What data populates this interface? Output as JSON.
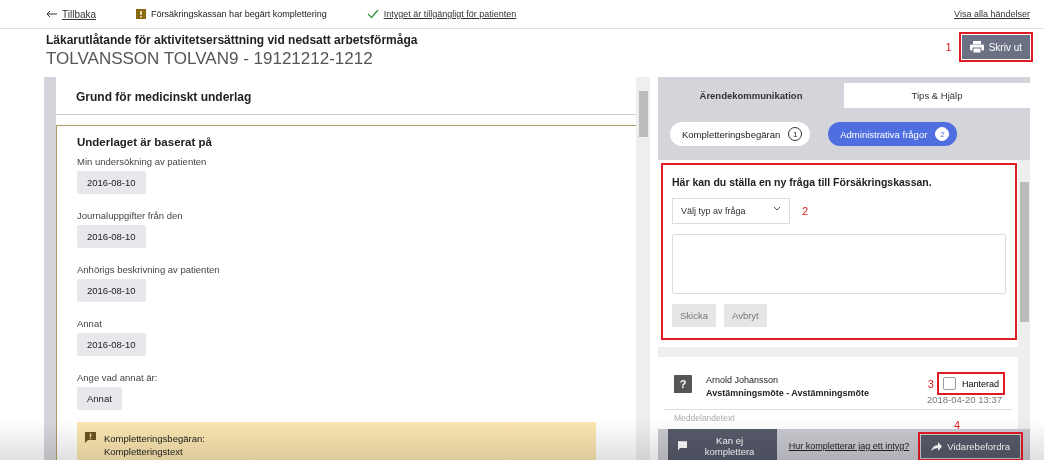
{
  "topbar": {
    "back": "Tillbaka",
    "status": [
      {
        "kind": "warning",
        "text": "Försäkringskassan har begärt komplettering"
      },
      {
        "kind": "ok",
        "text": "Intyget är tillgängligt för patienten"
      }
    ],
    "events_link": "Visa alla händelser"
  },
  "header": {
    "title": "Läkarutlåtande för aktivitetsersättning vid nedsatt arbetsförmåga",
    "patient": "TOLVANSSON TOLVAN9 - 19121212-1212",
    "print": {
      "label": "Skriv ut",
      "callout": "1"
    }
  },
  "form": {
    "section_title": "Grund för medicinskt underlag",
    "group_title": "Underlaget är baserat på",
    "fields": [
      {
        "label": "Min undersökning av patienten",
        "value": "2016-08-10"
      },
      {
        "label": "Journaluppgifter från den",
        "value": "2016-08-10"
      },
      {
        "label": "Anhörigs beskrivning av patienten",
        "value": "2016-08-10"
      },
      {
        "label": "Annat",
        "value": "2016-08-10"
      },
      {
        "label": "Ange vad annat är:",
        "value": "Annat"
      }
    ],
    "notice": {
      "title": "Kompletteringsbegäran:",
      "text": "Kompletteringstext"
    }
  },
  "sidepanel": {
    "tabs": [
      {
        "label": "Ärendekommunikation",
        "selected": true
      },
      {
        "label": "Tips & Hjälp",
        "selected": false
      }
    ],
    "filters": [
      {
        "label": "Kompletteringsbegäran",
        "count": "1",
        "selected": false
      },
      {
        "label": "Administrativa frågor",
        "count": "2",
        "selected": true
      }
    ],
    "new_question": {
      "callout": "2",
      "heading": "Här kan du ställa en ny fråga till Försäkringskassan.",
      "type_select": "Välj typ av fråga",
      "buttons": [
        {
          "label": "Skicka",
          "disabled": true
        },
        {
          "label": "Avbryt",
          "disabled": true
        }
      ]
    },
    "message": {
      "icon": "?",
      "sender": "Arnold Johansson",
      "subject": "Avstämningsmöte - Avstämningsmöte",
      "handled": {
        "label": "Hanterad",
        "checked": false,
        "callout": "3"
      },
      "time": "2018-04-20 13:37",
      "body": "Meddelandetext"
    },
    "footer": {
      "cannot_complete": "Kan ej komplettera",
      "help_link": "Hur kompletterar jag ett intyg?",
      "forward": {
        "label": "Vidarebefordra",
        "callout": "4"
      }
    }
  }
}
